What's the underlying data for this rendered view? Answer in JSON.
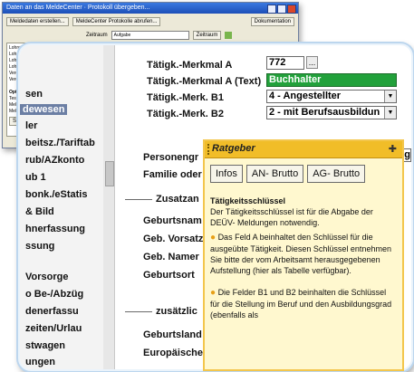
{
  "back_window": {
    "title": "Daten an das MeldeCenter · Protokoll übergeben...",
    "toolbar": {
      "btn_create": "Meldedaten erstellen...",
      "btn_fetch": "MeldeCenter Protokolle abrufen...",
      "btn_doc": "Dokumentation"
    },
    "filter": {
      "label": "Zeitraum",
      "value": "Aufgabe",
      "range_label": "Zeitraum"
    },
    "list_items": [
      "Lohnsteuerbescheinigungen",
      "Lohnsteuer...",
      "Lohnsteuer...",
      "Lohnsteuer...",
      "Verdienstn...",
      "Verdienst",
      "",
      "Optionen",
      "Testdurchlauf",
      "MeldeCenter...",
      "MeldeCenter..."
    ],
    "send_button": "Send"
  },
  "sidebar": {
    "items": [
      {
        "label": "sen",
        "active": false
      },
      {
        "label": "dewesen",
        "active": true
      },
      {
        "label": "ler",
        "active": false
      },
      {
        "label": "beitsz./Tariftab",
        "active": false
      },
      {
        "label": "rub/AZkonto",
        "active": false
      },
      {
        "label": "ub 1",
        "active": false
      },
      {
        "label": "bonk./eStatis",
        "active": false
      },
      {
        "label": "& Bild",
        "active": false
      },
      {
        "label": "hnerfassung",
        "active": false
      },
      {
        "label": "ssung",
        "active": false
      },
      {
        "label": "Vorsorge",
        "active": false
      },
      {
        "label": "o Be-/Abzüg",
        "active": false
      },
      {
        "label": "denerfassu",
        "active": false
      },
      {
        "label": "zeiten/Urlau",
        "active": false
      },
      {
        "label": "stwagen",
        "active": false
      },
      {
        "label": "ungen",
        "active": false
      }
    ]
  },
  "form": {
    "merkmal_a_label": "Tätigk.-Merkmal A",
    "merkmal_a_value": "772",
    "merkmal_a_text_label": "Tätigk.-Merkmal A (Text)",
    "merkmal_a_text_value": "Buchhalter",
    "merk_b1_label": "Tätigk.-Merk. B1",
    "merk_b1_value": "4 - Angestellter",
    "merk_b2_label": "Tätigk.-Merk. B2",
    "merk_b2_value": "2 - mit Berufsausbildun",
    "personengruppe_label": "Personengr",
    "familie_label": "Familie oder",
    "zusatz_section": "Zusatzan",
    "geburtsname_label": "Geburtsnam",
    "geb_vorsatz_label": "Geb. Vorsatz",
    "geb_namen_label": "Geb. Namer",
    "geburtsort_label": "Geburtsort",
    "zusaetzlich_section": "zusätzlic",
    "geburtsland_label": "Geburtsland",
    "europaeisch_label": "Europäische",
    "right_cut_text": "tig"
  },
  "ratgeber": {
    "title": "Ratgeber",
    "tabs": [
      "Infos",
      "AN- Brutto",
      "AG- Brutto"
    ],
    "heading": "Tätigkeitsschlüssel",
    "intro": "Der Tätigkeitsschlüssel ist für die Abgabe der DEÜV- Meldungen notwendig.",
    "para1": "Das Feld A beinhaltet den Schlüssel für die ausgeübte Tätigkeit. Diesen Schlüssel entnehmen Sie bitte der vom Arbeitsamt herausgegebenen Aufstellung (hier als Tabelle verfügbar).",
    "para2": "Die Felder B1 und B2 beinhalten die Schlüssel für die Stellung im Beruf und den Ausbildungsgrad (ebenfalls als"
  },
  "colors": {
    "active_sidebar": "#6c7fa4",
    "green_field": "#22a13b",
    "ratgeber_header": "#f1bd28",
    "ratgeber_bg": "#fff8cf"
  }
}
